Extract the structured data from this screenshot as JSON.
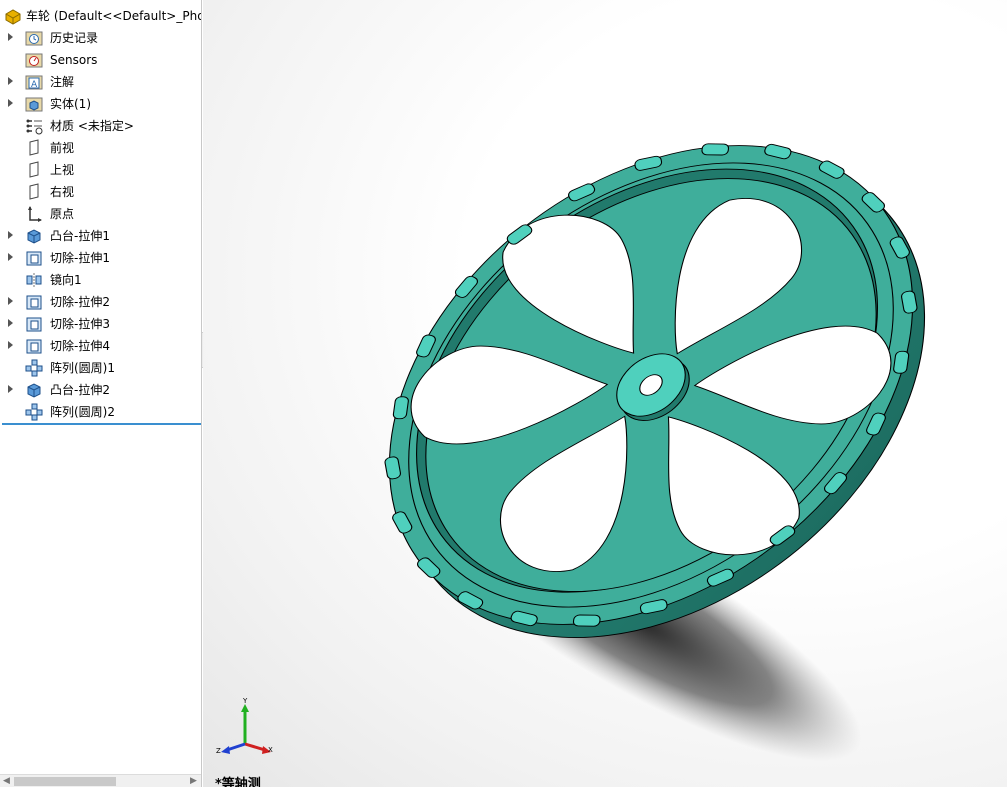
{
  "window": {
    "title": "车轮  (Default<<Default>_Phot"
  },
  "tree": {
    "items": [
      {
        "label": "历史记录",
        "icon": "history-folder-icon",
        "expandable": true
      },
      {
        "label": "Sensors",
        "icon": "sensors-icon",
        "expandable": false
      },
      {
        "label": "注解",
        "icon": "annotations-icon",
        "expandable": true
      },
      {
        "label": "实体(1)",
        "icon": "solid-bodies-icon",
        "expandable": true
      },
      {
        "label": "材质 <未指定>",
        "icon": "material-icon",
        "expandable": false
      },
      {
        "label": "前视",
        "icon": "plane-icon",
        "expandable": false
      },
      {
        "label": "上视",
        "icon": "plane-icon",
        "expandable": false
      },
      {
        "label": "右视",
        "icon": "plane-icon",
        "expandable": false
      },
      {
        "label": "原点",
        "icon": "origin-icon",
        "expandable": false
      },
      {
        "label": "凸台-拉伸1",
        "icon": "boss-extrude-icon",
        "expandable": true
      },
      {
        "label": "切除-拉伸1",
        "icon": "cut-extrude-icon",
        "expandable": true
      },
      {
        "label": "镜向1",
        "icon": "mirror-icon",
        "expandable": false
      },
      {
        "label": "切除-拉伸2",
        "icon": "cut-extrude-icon",
        "expandable": true
      },
      {
        "label": "切除-拉伸3",
        "icon": "cut-extrude-icon",
        "expandable": true
      },
      {
        "label": "切除-拉伸4",
        "icon": "cut-extrude-icon",
        "expandable": true
      },
      {
        "label": "阵列(圆周)1",
        "icon": "circular-pattern-icon",
        "expandable": false
      },
      {
        "label": "凸台-拉伸2",
        "icon": "boss-extrude-icon",
        "expandable": true
      },
      {
        "label": "阵列(圆周)2",
        "icon": "circular-pattern-icon",
        "expandable": false
      }
    ]
  },
  "viewport": {
    "view_label": "*等轴测",
    "triad": {
      "x": "X",
      "y": "Y",
      "z": "Z"
    }
  },
  "colors": {
    "model_face": "#3fae9b",
    "model_light": "#4fd0bd",
    "model_dark": "#217a6c",
    "rollback": "#3a8fd0",
    "axis_x": "#d02020",
    "axis_y": "#20b020",
    "axis_z": "#2040d0"
  }
}
